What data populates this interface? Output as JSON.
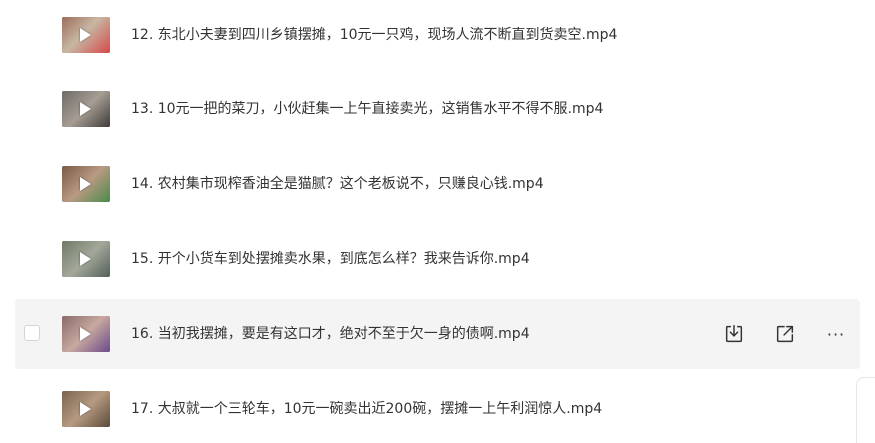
{
  "files": [
    {
      "name": "12. 东北小夫妻到四川乡镇摆摊，10元一只鸡，现场人流不断直到货卖空.mp4",
      "thumb_colors": [
        "#9c6b5a",
        "#c7b7a3",
        "#d44a4a"
      ]
    },
    {
      "name": "13. 10元一把的菜刀，小伙赶集一上午直接卖光，这销售水平不得不服.mp4",
      "thumb_colors": [
        "#6e6a66",
        "#a69d94",
        "#3e3b38"
      ]
    },
    {
      "name": "14. 农村集市现榨香油全是猫腻？这个老板说不，只赚良心钱.mp4",
      "thumb_colors": [
        "#7a5a46",
        "#b89a82",
        "#4a8a4a"
      ]
    },
    {
      "name": "15. 开个小货车到处摆摊卖水果，到底怎么样？我来告诉你.mp4",
      "thumb_colors": [
        "#6f7a66",
        "#a3a89a",
        "#54605a"
      ]
    },
    {
      "name": "16. 当初我摆摊，要是有这口才，绝对不至于欠一身的债啊.mp4",
      "thumb_colors": [
        "#8a6a6a",
        "#c8a8a0",
        "#6a4a8a"
      ],
      "selected": true
    },
    {
      "name": "17. 大叔就一个三轮车，10元一碗卖出近200碗，摆摊一上午利润惊人.mp4",
      "thumb_colors": [
        "#7a6450",
        "#b69a80",
        "#5a4a3a"
      ]
    }
  ],
  "actions": {
    "download_icon": "download-icon",
    "share_icon": "share-icon",
    "more_label": "···"
  }
}
